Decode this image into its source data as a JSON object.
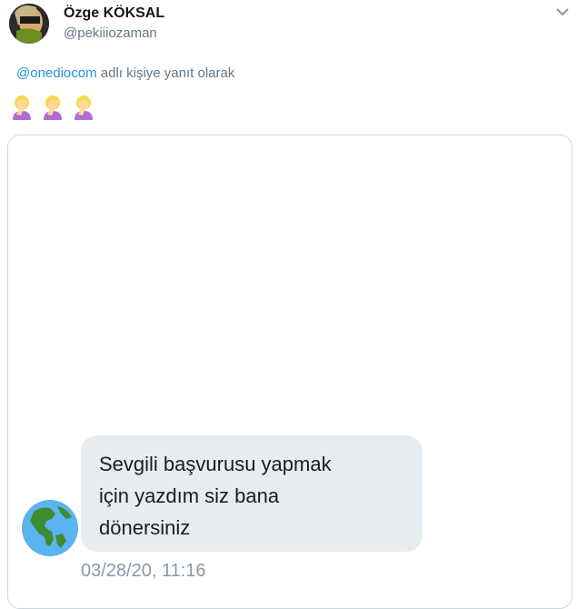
{
  "tweet": {
    "display_name": "Özge KÖKSAL",
    "handle": "@pekiiiozaman",
    "reply_mention": "@onediocom",
    "reply_suffix": " adlı kişiye yanıt olarak",
    "emojis": [
      "woman-facepalming-icon",
      "woman-facepalming-icon",
      "woman-facepalming-icon"
    ]
  },
  "media": {
    "message_text_line1": "Sevgili başvurusu yapmak",
    "message_text_line2": "için yazdım siz bana",
    "message_text_line3": "dönersiniz",
    "timestamp": "03/28/20, 11:16",
    "avatar_icon": "globe-americas-icon"
  },
  "colors": {
    "link": "#1b95e0",
    "muted": "#657786",
    "bubble": "#e6ecf0",
    "border": "#ccd6dd"
  }
}
